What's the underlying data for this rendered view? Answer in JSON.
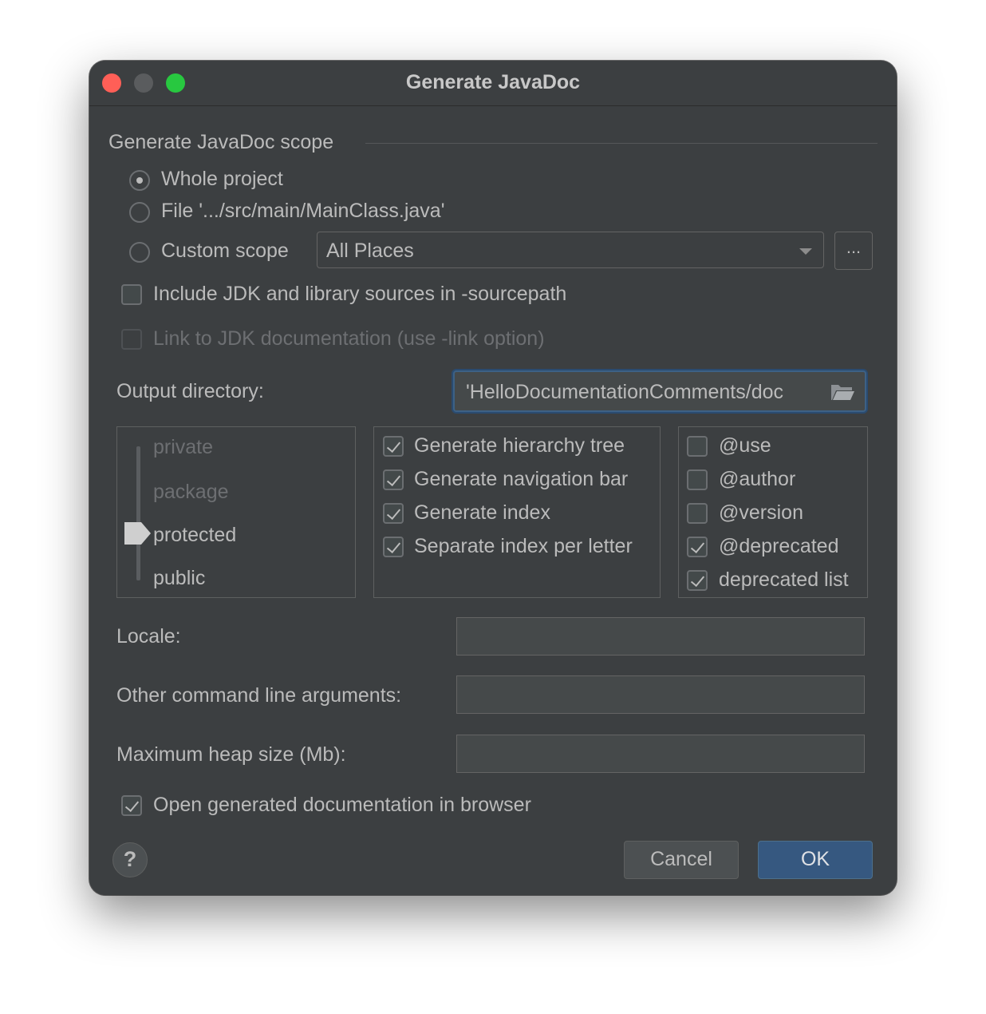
{
  "window": {
    "title": "Generate JavaDoc"
  },
  "scope": {
    "heading": "Generate JavaDoc scope",
    "options": [
      {
        "label": "Whole project",
        "selected": true
      },
      {
        "label": "File '.../src/main/MainClass.java'",
        "selected": false
      },
      {
        "label": "Custom scope",
        "selected": false
      }
    ],
    "custom_scope_value": "All Places",
    "ellipsis_label": "..."
  },
  "options": {
    "include_jdk": {
      "label": "Include JDK and library sources in -sourcepath",
      "checked": false
    },
    "link_jdk": {
      "label": "Link to JDK documentation (use -link option)",
      "checked": false,
      "enabled": false
    }
  },
  "output": {
    "label": "Output directory:",
    "value": "'HelloDocumentationComments/doc"
  },
  "visibility": {
    "levels": [
      "private",
      "package",
      "protected",
      "public"
    ],
    "selected": "protected"
  },
  "generate": [
    {
      "label": "Generate hierarchy tree",
      "checked": true
    },
    {
      "label": "Generate navigation bar",
      "checked": true
    },
    {
      "label": "Generate index",
      "checked": true
    },
    {
      "label": "Separate index per letter",
      "checked": true
    }
  ],
  "tags": [
    {
      "label": "@use",
      "checked": false
    },
    {
      "label": "@author",
      "checked": false
    },
    {
      "label": "@version",
      "checked": false
    },
    {
      "label": "@deprecated",
      "checked": true
    },
    {
      "label": "deprecated list",
      "checked": true
    }
  ],
  "fields": {
    "locale_label": "Locale:",
    "locale_value": "",
    "args_label": "Other command line arguments:",
    "args_value": "",
    "heap_label": "Maximum heap size (Mb):",
    "heap_value": ""
  },
  "open_browser": {
    "label": "Open generated documentation in browser",
    "checked": true
  },
  "buttons": {
    "help": "?",
    "cancel": "Cancel",
    "ok": "OK"
  }
}
